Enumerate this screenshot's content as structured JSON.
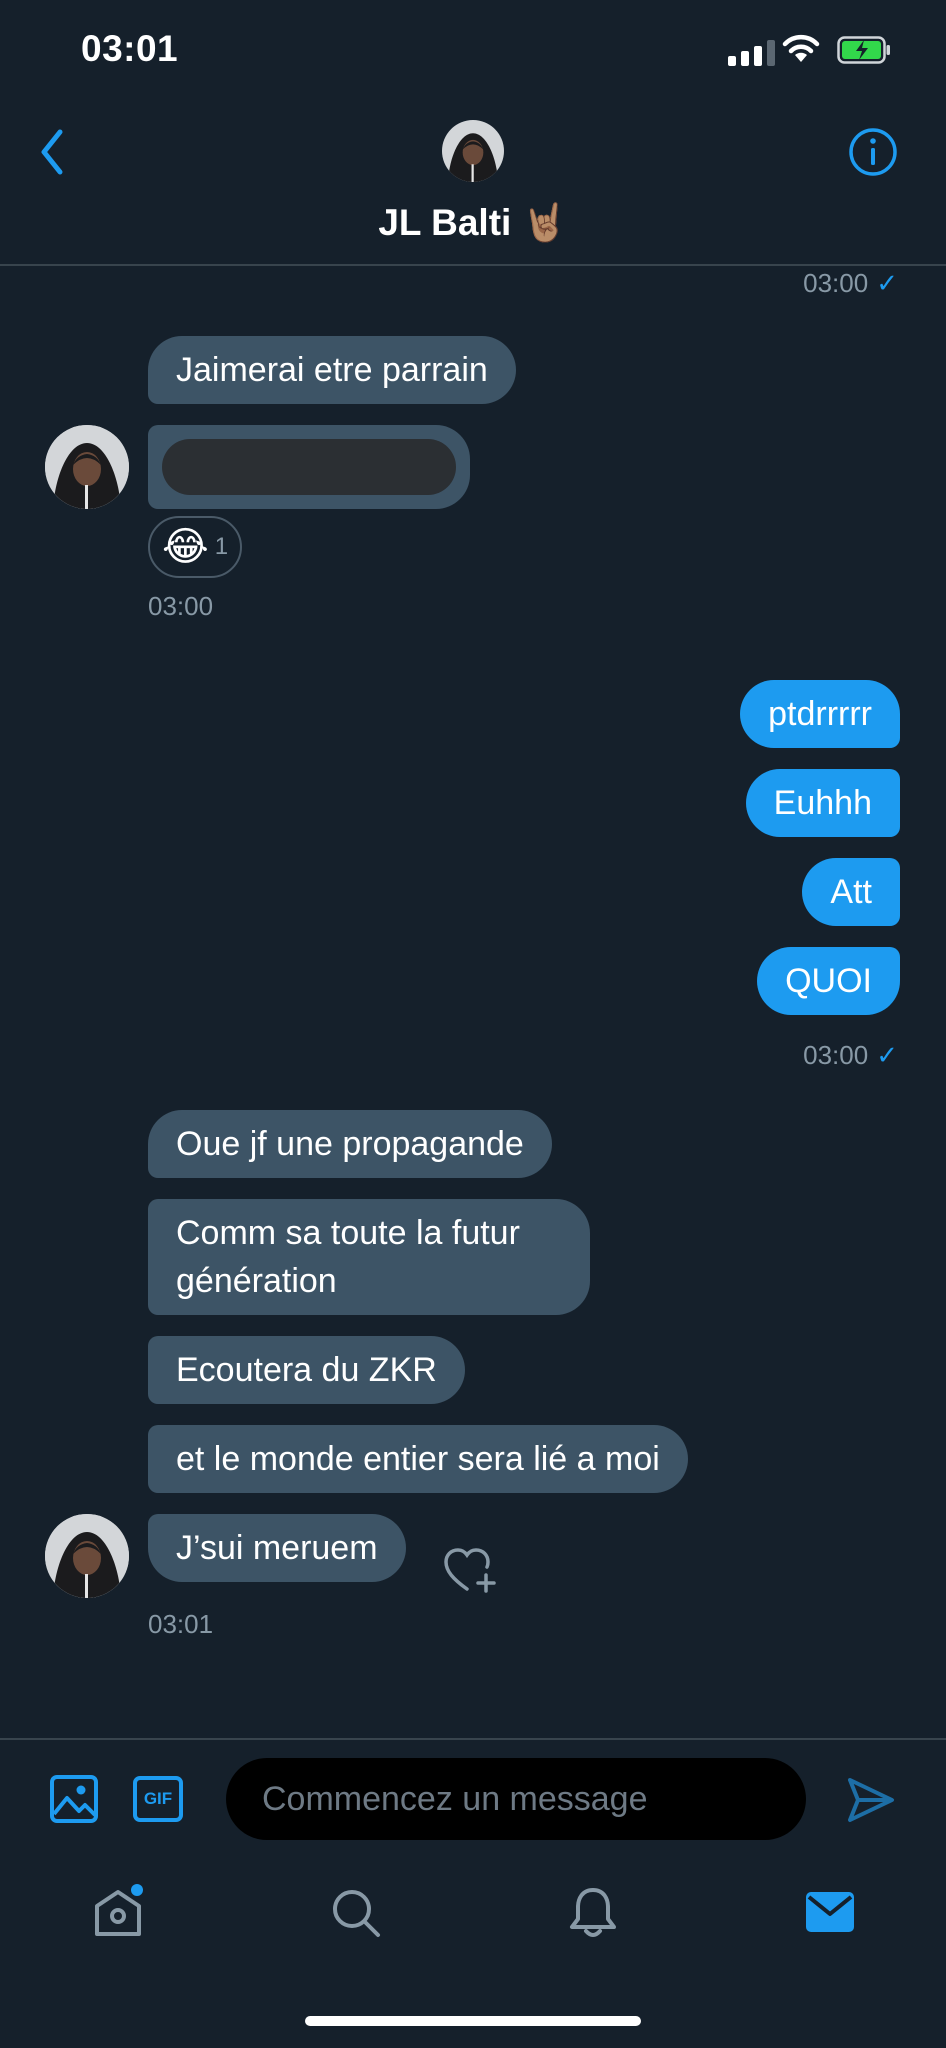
{
  "status_bar": {
    "time": "03:01"
  },
  "header": {
    "contact_name": "JL Balti 🤘🏽",
    "back_icon": "chevron-left-icon",
    "info_icon": "info-icon"
  },
  "messages": {
    "top_meta": {
      "time": "03:00"
    },
    "group1": {
      "bubble1": "Jaimerai etre parrain",
      "reaction": {
        "emoji": "😂",
        "count": "1"
      },
      "time": "03:00"
    },
    "group2": {
      "bubbles": [
        "ptdrrrrr",
        "Euhhh",
        "Att",
        "QUOI"
      ],
      "time": "03:00"
    },
    "group3": {
      "bubbles": [
        "Oue jf une propagande",
        "Comm sa toute la futur génération",
        "Ecoutera du ZKR",
        "et le monde entier sera lié a moi",
        "J’sui meruem"
      ],
      "time": "03:01"
    }
  },
  "composer": {
    "placeholder": "Commencez un message",
    "media_icon": "image-icon",
    "gif_label": "GIF",
    "send_icon": "send-icon"
  },
  "nav": {
    "items": [
      "home-icon",
      "search-icon",
      "notifications-icon",
      "messages-icon"
    ]
  },
  "colors": {
    "background": "#15202b",
    "incoming_bubble": "#3d5466",
    "outgoing_bubble": "#1d9bf0",
    "accent": "#1d9bf0",
    "muted_text": "#8899a6"
  }
}
